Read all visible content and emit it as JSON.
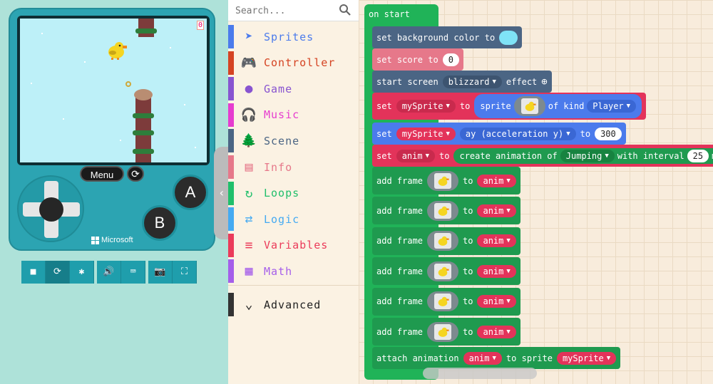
{
  "simulator": {
    "score": "0",
    "menu_label": "Menu",
    "reset_glyph": "⟳",
    "button_a": "A",
    "button_b": "B",
    "brand": "Microsoft",
    "toolbar": [
      {
        "name": "stop-icon",
        "glyph": "■"
      },
      {
        "name": "restart-icon",
        "glyph": "⟳"
      },
      {
        "name": "debug-icon",
        "glyph": "✱"
      },
      {
        "name": "volume-icon",
        "glyph": "🔊"
      },
      {
        "name": "keyboard-icon",
        "glyph": "⌨"
      },
      {
        "name": "screenshot-icon",
        "glyph": "📷"
      },
      {
        "name": "fullscreen-icon",
        "glyph": "⛶"
      }
    ],
    "collapse_glyph": "‹"
  },
  "toolbox": {
    "search_placeholder": "Search...",
    "categories": [
      {
        "label": "Sprites",
        "color": "#4b7bec",
        "icon": "➤"
      },
      {
        "label": "Controller",
        "color": "#d54322",
        "icon": "🎮"
      },
      {
        "label": "Game",
        "color": "#8854d0",
        "icon": "●"
      },
      {
        "label": "Music",
        "color": "#e63ccf",
        "icon": "🎧"
      },
      {
        "label": "Scene",
        "color": "#4b6584",
        "icon": "🌲"
      },
      {
        "label": "Info",
        "color": "#e6788a",
        "icon": "▤"
      },
      {
        "label": "Loops",
        "color": "#20bf6b",
        "icon": "↻"
      },
      {
        "label": "Logic",
        "color": "#45aaf2",
        "icon": "⇄"
      },
      {
        "label": "Variables",
        "color": "#eb3b5a",
        "icon": "≡"
      },
      {
        "label": "Math",
        "color": "#a55eea",
        "icon": "▦"
      }
    ],
    "advanced": {
      "label": "Advanced",
      "icon": "⌄"
    }
  },
  "workspace": {
    "hat": "on start",
    "set_bg": {
      "text": "set background color to",
      "color": "#7fe3f7"
    },
    "set_score": {
      "text": "set score to",
      "value": "0"
    },
    "effect": {
      "pre": "start screen",
      "name": "blizzard",
      "post": "effect",
      "plus": "⊕"
    },
    "set_sprite": {
      "set": "set",
      "var": "mySprite",
      "to": "to",
      "sprite": "sprite",
      "of_kind": "of kind",
      "kind": "Player"
    },
    "set_ay": {
      "set": "set",
      "var": "mySprite",
      "prop": "ay (acceleration y)",
      "to": "to",
      "value": "300"
    },
    "set_anim": {
      "set": "set",
      "var": "anim",
      "to": "to",
      "create": "create animation of",
      "action": "Jumping",
      "with": "with interval",
      "value": "25",
      "unit": "ms"
    },
    "add_frames": [
      {
        "add": "add frame",
        "to": "to",
        "var": "anim"
      },
      {
        "add": "add frame",
        "to": "to",
        "var": "anim"
      },
      {
        "add": "add frame",
        "to": "to",
        "var": "anim"
      },
      {
        "add": "add frame",
        "to": "to",
        "var": "anim"
      },
      {
        "add": "add frame",
        "to": "to",
        "var": "anim"
      },
      {
        "add": "add frame",
        "to": "to",
        "var": "anim"
      }
    ],
    "attach": {
      "text": "attach animation",
      "anim": "anim",
      "to": "to sprite",
      "sprite": "mySprite"
    },
    "colors": {
      "loops": "#20b358",
      "scene": "#4b6584",
      "info": "#e6788a",
      "sprites": "#4b7bec",
      "variables": "#e3335a",
      "animation": "#1f9a4f"
    }
  }
}
